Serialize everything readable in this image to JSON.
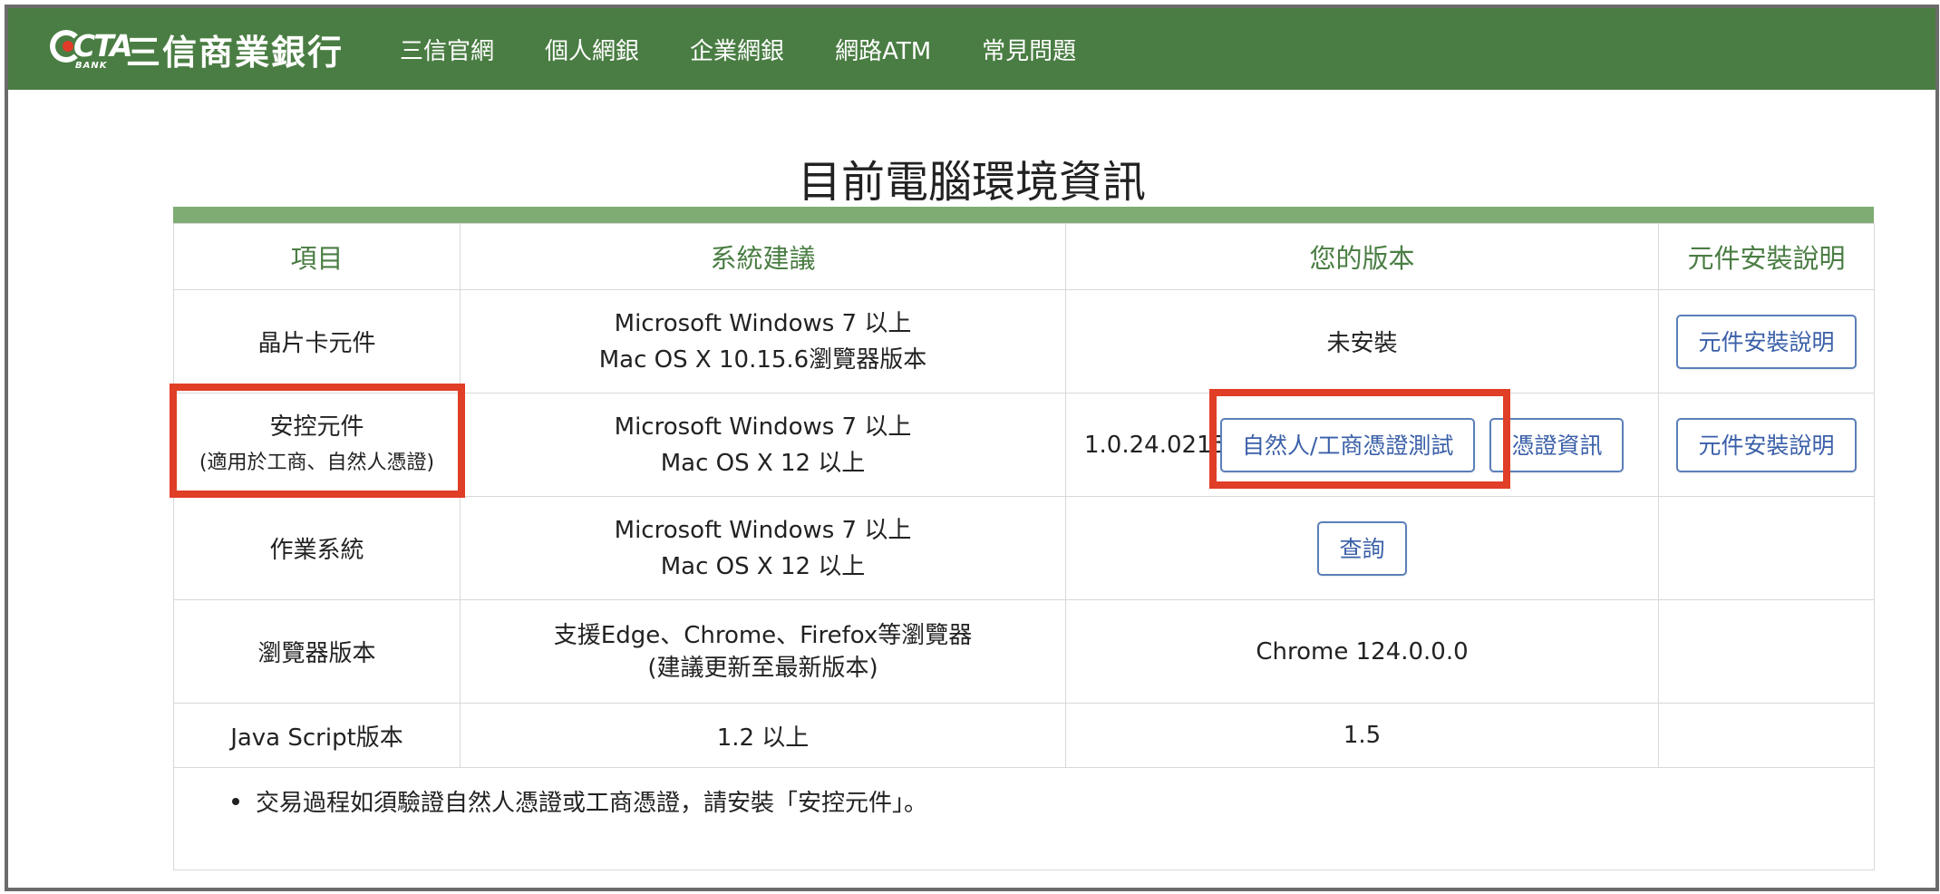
{
  "header": {
    "brand_mark": "CTA",
    "brand_sub": "BANK",
    "bank_name": "三信商業銀行",
    "nav": [
      "三信官網",
      "個人網銀",
      "企業網銀",
      "網路ATM",
      "常見問題"
    ]
  },
  "page": {
    "title": "目前電腦環境資訊"
  },
  "table": {
    "headers": [
      "項目",
      "系統建議",
      "您的版本",
      "元件安裝說明"
    ],
    "rows": [
      {
        "item": "晶片卡元件",
        "suggest_line1": "Microsoft Windows 7 以上",
        "suggest_line2": "Mac OS X 10.15.6瀏覽器版本",
        "version": "未安裝",
        "guide_button": "元件安裝說明"
      },
      {
        "item": "安控元件",
        "item_sub": "(適用於工商、自然人憑證)",
        "suggest_line1": "Microsoft Windows 7 以上",
        "suggest_line2": "Mac OS X 12 以上",
        "version": "1.0.24.0215",
        "test_button": "自然人/工商憑證測試",
        "cert_info_button": "憑證資訊",
        "guide_button": "元件安裝說明"
      },
      {
        "item": "作業系統",
        "suggest_line1": "Microsoft Windows 7 以上",
        "suggest_line2": "Mac OS X 12 以上",
        "query_button": "查詢"
      },
      {
        "item": "瀏覽器版本",
        "suggest_line1": "支援Edge、Chrome、Firefox等瀏覽器",
        "suggest_line2": "(建議更新至最新版本)",
        "version": "Chrome 124.0.0.0"
      },
      {
        "item": "Java Script版本",
        "suggest_line1": "1.2 以上",
        "version": "1.5"
      }
    ],
    "note": "交易過程如須驗證自然人憑證或工商憑證，請安裝「安控元件」。"
  },
  "colors": {
    "header_green": "#4a7d43",
    "table_bar_green": "#7eac73",
    "button_blue": "#3a5fa8",
    "highlight_red": "#e03e27"
  }
}
